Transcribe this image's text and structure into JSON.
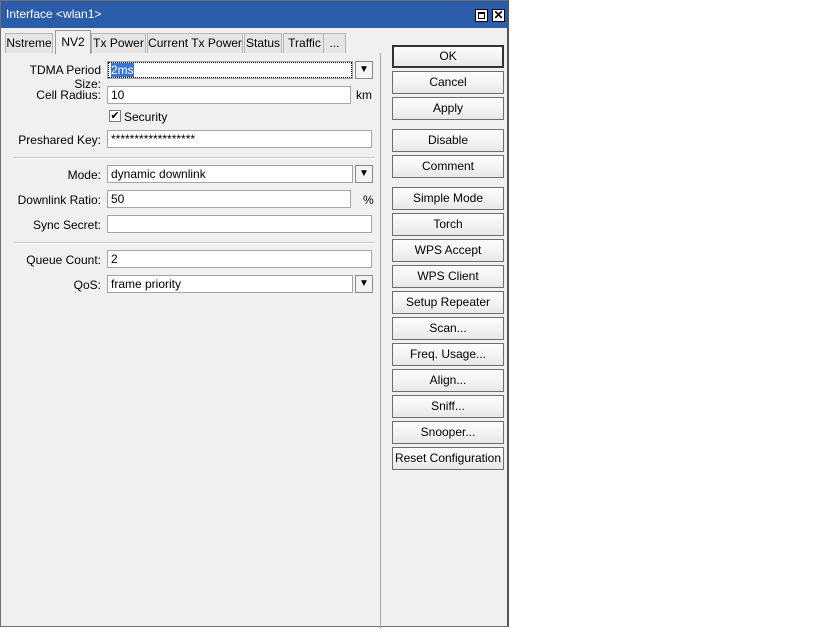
{
  "window": {
    "title": "Interface <wlan1>"
  },
  "tabs": [
    "Nstreme",
    "NV2",
    "Tx Power",
    "Current Tx Power",
    "Status",
    "Traffic",
    "..."
  ],
  "form": {
    "tdma_label": "TDMA Period Size:",
    "tdma_value": "2ms",
    "cell_radius_label": "Cell Radius:",
    "cell_radius_value": "10",
    "cell_radius_unit": "km",
    "security_label": "Security",
    "security_checked": true,
    "preshared_label": "Preshared Key:",
    "preshared_value": "******************",
    "mode_label": "Mode:",
    "mode_value": "dynamic downlink",
    "downlink_label": "Downlink Ratio:",
    "downlink_value": "50",
    "downlink_unit": "%",
    "sync_label": "Sync Secret:",
    "sync_value": "",
    "queue_label": "Queue Count:",
    "queue_value": "2",
    "qos_label": "QoS:",
    "qos_value": "frame priority"
  },
  "buttons": {
    "ok": "OK",
    "cancel": "Cancel",
    "apply": "Apply",
    "disable": "Disable",
    "comment": "Comment",
    "simple_mode": "Simple Mode",
    "torch": "Torch",
    "wps_accept": "WPS Accept",
    "wps_client": "WPS Client",
    "setup_repeater": "Setup Repeater",
    "scan": "Scan...",
    "freq_usage": "Freq. Usage...",
    "align": "Align...",
    "sniff": "Sniff...",
    "snooper": "Snooper...",
    "reset_config": "Reset Configuration"
  },
  "icons": {
    "dropdown": "dropdown-arrow-icon",
    "maximize": "maximize-icon",
    "close": "close-icon"
  }
}
